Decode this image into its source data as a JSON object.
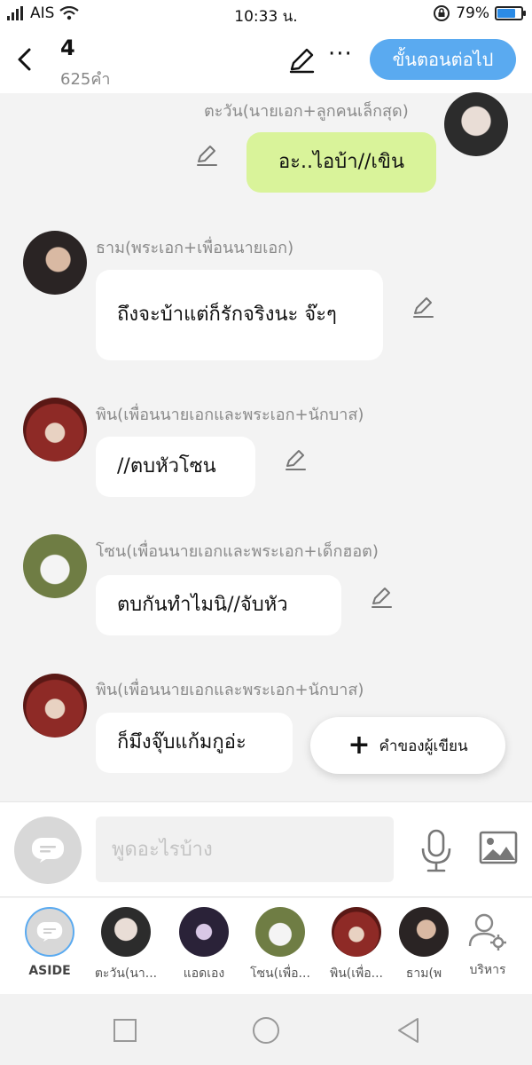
{
  "status": {
    "carrier": "AIS",
    "time": "10:33 น.",
    "battery": "79%",
    "battery_level": 0.79
  },
  "header": {
    "title": "4",
    "word_count": "625คำ",
    "next_button": "ขั้นตอนต่อไป",
    "more": "···"
  },
  "messages": [
    {
      "name": "ตะวัน(นายเอก+ลูกคนเล็กสุด)",
      "text": "อะ..ไอบ้า//เขิน",
      "side": "right"
    },
    {
      "name": "ธาม(พระเอก+เพื่อนนายเอก)",
      "text": "ถึงจะบ้าแต่ก็รักจริงนะ จ๊ะๆ",
      "side": "left"
    },
    {
      "name": "พิน(เพื่อนนายเอกและพระเอก+นักบาส)",
      "text": "//ตบหัวโซน",
      "side": "left"
    },
    {
      "name": "โซน(เพื่อนนายเอกและพระเอก+เด็กฮอต)",
      "text": "ตบกันทำไมนิ//จับหัว",
      "side": "left"
    },
    {
      "name": "พิน(เพื่อนนายเอกและพระเอก+นักบาส)",
      "text": "ก็มึงจุ๊บแก้มกูอ่ะ",
      "side": "left"
    }
  ],
  "fab": {
    "label": "คำของผู้เขียน"
  },
  "composer": {
    "placeholder": "พูดอะไรบ้าง"
  },
  "characters": [
    {
      "label": "ASIDE"
    },
    {
      "label": "ตะวัน(นา..."
    },
    {
      "label": "แอดเอง"
    },
    {
      "label": "โซน(เพื่อ..."
    },
    {
      "label": "พิน(เพื่อ..."
    },
    {
      "label": "ธาม(พ"
    },
    {
      "label": "บริหาร"
    }
  ],
  "colors": {
    "accent": "#5aaaf0",
    "my_bubble": "#d9f39a"
  }
}
